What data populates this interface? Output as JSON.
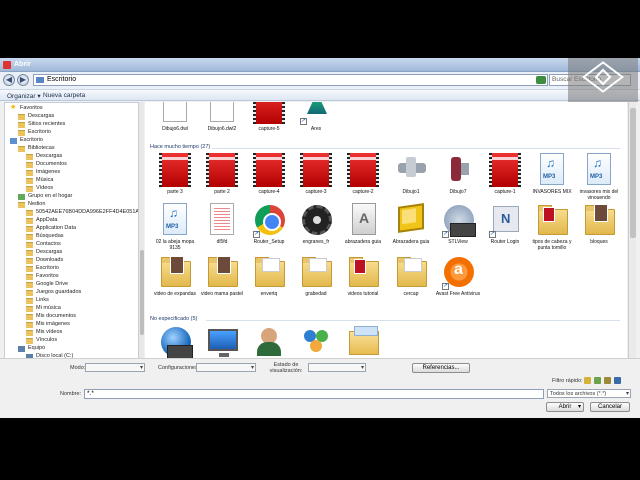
{
  "window": {
    "title": "Abrir"
  },
  "nav": {
    "back": "◀",
    "forward": "▶",
    "address": "Escritorio",
    "address_drop": "▾",
    "search_placeholder": "Buscar Escritorio"
  },
  "toolbar": {
    "organize": "Organizar ▾",
    "new_folder": "Nueva carpeta"
  },
  "sidebar": {
    "items": [
      {
        "label": "Favoritos",
        "icon": "star-icon",
        "indent": 0
      },
      {
        "label": "Descargas",
        "icon": "folder-icon",
        "indent": 1
      },
      {
        "label": "Sitios recientes",
        "icon": "folder-icon",
        "indent": 1
      },
      {
        "label": "Escritorio",
        "icon": "folder-icon",
        "indent": 1
      },
      {
        "label": "Escritorio",
        "icon": "desktop-icon",
        "indent": 0
      },
      {
        "label": "Bibliotecas",
        "icon": "library-icon",
        "indent": 1
      },
      {
        "label": "Descargas",
        "icon": "folder-icon",
        "indent": 2
      },
      {
        "label": "Documentos",
        "icon": "folder-icon",
        "indent": 2
      },
      {
        "label": "Imágenes",
        "icon": "folder-icon",
        "indent": 2
      },
      {
        "label": "Música",
        "icon": "folder-icon",
        "indent": 2
      },
      {
        "label": "Vídeos",
        "icon": "folder-icon",
        "indent": 2
      },
      {
        "label": "Grupo en el hogar",
        "icon": "homegroup-icon",
        "indent": 1
      },
      {
        "label": "Nedion",
        "icon": "user-icon",
        "indent": 1
      },
      {
        "label": "50542AEE76B04DDA996E2FF4D4E051A.TMP",
        "icon": "folder-icon",
        "indent": 2
      },
      {
        "label": "AppData",
        "icon": "folder-icon",
        "indent": 2
      },
      {
        "label": "Application Data",
        "icon": "folder-icon",
        "indent": 2
      },
      {
        "label": "Búsquedas",
        "icon": "folder-icon",
        "indent": 2
      },
      {
        "label": "Contactos",
        "icon": "folder-icon",
        "indent": 2
      },
      {
        "label": "Descargas",
        "icon": "folder-icon",
        "indent": 2
      },
      {
        "label": "Downloads",
        "icon": "folder-icon",
        "indent": 2
      },
      {
        "label": "Escritorio",
        "icon": "folder-icon",
        "indent": 2
      },
      {
        "label": "Favoritos",
        "icon": "folder-icon",
        "indent": 2
      },
      {
        "label": "Google Drive",
        "icon": "folder-icon",
        "indent": 2
      },
      {
        "label": "Juegos guardados",
        "icon": "folder-icon",
        "indent": 2
      },
      {
        "label": "Links",
        "icon": "folder-icon",
        "indent": 2
      },
      {
        "label": "Mi música",
        "icon": "folder-icon",
        "indent": 2
      },
      {
        "label": "Mis documentos",
        "icon": "folder-icon",
        "indent": 2
      },
      {
        "label": "Mis imágenes",
        "icon": "folder-icon",
        "indent": 2
      },
      {
        "label": "Mis vídeos",
        "icon": "folder-icon",
        "indent": 2
      },
      {
        "label": "Vínculos",
        "icon": "folder-icon",
        "indent": 2
      },
      {
        "label": "Equipo",
        "icon": "computer-icon",
        "indent": 1
      },
      {
        "label": "Disco local (C:)",
        "icon": "drive-icon",
        "indent": 2
      }
    ]
  },
  "groups": {
    "top": {
      "files": [
        {
          "label": "Dibujo6.dwl",
          "kind": "blank"
        },
        {
          "label": "Dibujo6.dwl2",
          "kind": "blank"
        },
        {
          "label": "capture-5",
          "kind": "film"
        },
        {
          "label": "Ares",
          "kind": "ares"
        }
      ]
    },
    "old": {
      "title": "Hace mucho tiempo (27)",
      "files": [
        {
          "label": "parte 3",
          "kind": "film"
        },
        {
          "label": "parte 2",
          "kind": "film"
        },
        {
          "label": "capture-4",
          "kind": "film"
        },
        {
          "label": "capture-3",
          "kind": "film"
        },
        {
          "label": "capture-2",
          "kind": "film"
        },
        {
          "label": "Dibujo1",
          "kind": "tool"
        },
        {
          "label": "Dibujo7",
          "kind": "tool2"
        },
        {
          "label": "capture-1",
          "kind": "film"
        },
        {
          "label": "INVASORES MIX",
          "kind": "mp3"
        },
        {
          "label": "invasores mix del vinouendo",
          "kind": "mp3"
        },
        {
          "label": "02 la abeja mopa 9135",
          "kind": "mp3"
        },
        {
          "label": "dl5fd",
          "kind": "doc"
        },
        {
          "label": "Router_Setup",
          "kind": "chrome"
        },
        {
          "label": "engranes_fr",
          "kind": "gear"
        },
        {
          "label": "abrazadera guia",
          "kind": "acro"
        },
        {
          "label": "Abrazadera guia",
          "kind": "cube"
        },
        {
          "label": "STLView",
          "kind": "stl"
        },
        {
          "label": "Router Login",
          "kind": "nsrv"
        },
        {
          "label": "tipos de cabeza y punta tornillo",
          "kind": "folder-red"
        },
        {
          "label": "bloques",
          "kind": "folder-dark"
        },
        {
          "label": "video de expandas",
          "kind": "folder-dark"
        },
        {
          "label": "video mama pastel",
          "kind": "folder-dark"
        },
        {
          "label": "envertq",
          "kind": "folder-wp"
        },
        {
          "label": "grabedad",
          "kind": "folder-wp"
        },
        {
          "label": "videos tutorial",
          "kind": "folder-red"
        },
        {
          "label": "cercap",
          "kind": "folder-wp"
        },
        {
          "label": "Avast Free Antivirus",
          "kind": "avast"
        }
      ]
    },
    "unspecified": {
      "title": "No especificado (5)",
      "files": [
        {
          "label": "Red",
          "kind": "globe"
        },
        {
          "label": "Equipo",
          "kind": "monitor"
        },
        {
          "label": "Nedion",
          "kind": "person"
        },
        {
          "label": "Grupo en el hogar",
          "kind": "homeg"
        },
        {
          "label": "Bibliotecas",
          "kind": "libr"
        }
      ]
    }
  },
  "options": {
    "mode_label": "Modo:",
    "config_label": "Configuraciones:",
    "state_label": "Estado de visualización:",
    "references": "Referencias..."
  },
  "footer": {
    "quick_filter": "Filtro rápido:",
    "name_label": "Nombre:",
    "name_value": "*.*",
    "filter_value": "Todos los archivos (*.*)",
    "open": "Abrir",
    "open_drop": "▾",
    "cancel": "Cancelar"
  },
  "colors": {
    "film_red": "#d11010",
    "folder_yellow": "#e7c05a",
    "group_text": "#1e3a6b",
    "title_grad": "#9fb8d8"
  }
}
